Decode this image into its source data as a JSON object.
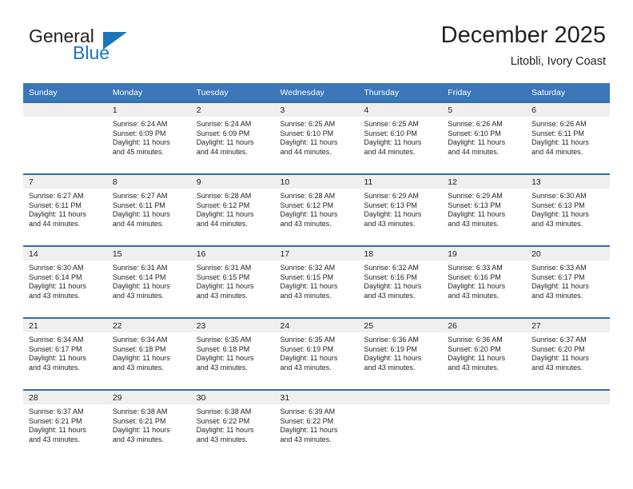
{
  "brand": {
    "name_part1": "General",
    "name_part2": "Blue",
    "color_dark": "#231f20",
    "color_blue": "#1b75bb"
  },
  "header": {
    "title": "December 2025",
    "subtitle": "Litobli, Ivory Coast"
  },
  "theme": {
    "header_row_bg": "#3a76b8",
    "row_divider": "#2e6ead",
    "daynum_band_bg": "#efefef",
    "text": "#231f20"
  },
  "weekday_headers": [
    "Sunday",
    "Monday",
    "Tuesday",
    "Wednesday",
    "Thursday",
    "Friday",
    "Saturday"
  ],
  "weeks": [
    [
      {
        "day": "",
        "sunrise": "",
        "sunset": "",
        "daylight1": "",
        "daylight2": ""
      },
      {
        "day": "1",
        "sunrise": "Sunrise: 6:24 AM",
        "sunset": "Sunset: 6:09 PM",
        "daylight1": "Daylight: 11 hours",
        "daylight2": "and 45 minutes."
      },
      {
        "day": "2",
        "sunrise": "Sunrise: 6:24 AM",
        "sunset": "Sunset: 6:09 PM",
        "daylight1": "Daylight: 11 hours",
        "daylight2": "and 44 minutes."
      },
      {
        "day": "3",
        "sunrise": "Sunrise: 6:25 AM",
        "sunset": "Sunset: 6:10 PM",
        "daylight1": "Daylight: 11 hours",
        "daylight2": "and 44 minutes."
      },
      {
        "day": "4",
        "sunrise": "Sunrise: 6:25 AM",
        "sunset": "Sunset: 6:10 PM",
        "daylight1": "Daylight: 11 hours",
        "daylight2": "and 44 minutes."
      },
      {
        "day": "5",
        "sunrise": "Sunrise: 6:26 AM",
        "sunset": "Sunset: 6:10 PM",
        "daylight1": "Daylight: 11 hours",
        "daylight2": "and 44 minutes."
      },
      {
        "day": "6",
        "sunrise": "Sunrise: 6:26 AM",
        "sunset": "Sunset: 6:11 PM",
        "daylight1": "Daylight: 11 hours",
        "daylight2": "and 44 minutes."
      }
    ],
    [
      {
        "day": "7",
        "sunrise": "Sunrise: 6:27 AM",
        "sunset": "Sunset: 6:11 PM",
        "daylight1": "Daylight: 11 hours",
        "daylight2": "and 44 minutes."
      },
      {
        "day": "8",
        "sunrise": "Sunrise: 6:27 AM",
        "sunset": "Sunset: 6:11 PM",
        "daylight1": "Daylight: 11 hours",
        "daylight2": "and 44 minutes."
      },
      {
        "day": "9",
        "sunrise": "Sunrise: 6:28 AM",
        "sunset": "Sunset: 6:12 PM",
        "daylight1": "Daylight: 11 hours",
        "daylight2": "and 44 minutes."
      },
      {
        "day": "10",
        "sunrise": "Sunrise: 6:28 AM",
        "sunset": "Sunset: 6:12 PM",
        "daylight1": "Daylight: 11 hours",
        "daylight2": "and 43 minutes."
      },
      {
        "day": "11",
        "sunrise": "Sunrise: 6:29 AM",
        "sunset": "Sunset: 6:13 PM",
        "daylight1": "Daylight: 11 hours",
        "daylight2": "and 43 minutes."
      },
      {
        "day": "12",
        "sunrise": "Sunrise: 6:29 AM",
        "sunset": "Sunset: 6:13 PM",
        "daylight1": "Daylight: 11 hours",
        "daylight2": "and 43 minutes."
      },
      {
        "day": "13",
        "sunrise": "Sunrise: 6:30 AM",
        "sunset": "Sunset: 6:13 PM",
        "daylight1": "Daylight: 11 hours",
        "daylight2": "and 43 minutes."
      }
    ],
    [
      {
        "day": "14",
        "sunrise": "Sunrise: 6:30 AM",
        "sunset": "Sunset: 6:14 PM",
        "daylight1": "Daylight: 11 hours",
        "daylight2": "and 43 minutes."
      },
      {
        "day": "15",
        "sunrise": "Sunrise: 6:31 AM",
        "sunset": "Sunset: 6:14 PM",
        "daylight1": "Daylight: 11 hours",
        "daylight2": "and 43 minutes."
      },
      {
        "day": "16",
        "sunrise": "Sunrise: 6:31 AM",
        "sunset": "Sunset: 6:15 PM",
        "daylight1": "Daylight: 11 hours",
        "daylight2": "and 43 minutes."
      },
      {
        "day": "17",
        "sunrise": "Sunrise: 6:32 AM",
        "sunset": "Sunset: 6:15 PM",
        "daylight1": "Daylight: 11 hours",
        "daylight2": "and 43 minutes."
      },
      {
        "day": "18",
        "sunrise": "Sunrise: 6:32 AM",
        "sunset": "Sunset: 6:16 PM",
        "daylight1": "Daylight: 11 hours",
        "daylight2": "and 43 minutes."
      },
      {
        "day": "19",
        "sunrise": "Sunrise: 6:33 AM",
        "sunset": "Sunset: 6:16 PM",
        "daylight1": "Daylight: 11 hours",
        "daylight2": "and 43 minutes."
      },
      {
        "day": "20",
        "sunrise": "Sunrise: 6:33 AM",
        "sunset": "Sunset: 6:17 PM",
        "daylight1": "Daylight: 11 hours",
        "daylight2": "and 43 minutes."
      }
    ],
    [
      {
        "day": "21",
        "sunrise": "Sunrise: 6:34 AM",
        "sunset": "Sunset: 6:17 PM",
        "daylight1": "Daylight: 11 hours",
        "daylight2": "and 43 minutes."
      },
      {
        "day": "22",
        "sunrise": "Sunrise: 6:34 AM",
        "sunset": "Sunset: 6:18 PM",
        "daylight1": "Daylight: 11 hours",
        "daylight2": "and 43 minutes."
      },
      {
        "day": "23",
        "sunrise": "Sunrise: 6:35 AM",
        "sunset": "Sunset: 6:18 PM",
        "daylight1": "Daylight: 11 hours",
        "daylight2": "and 43 minutes."
      },
      {
        "day": "24",
        "sunrise": "Sunrise: 6:35 AM",
        "sunset": "Sunset: 6:19 PM",
        "daylight1": "Daylight: 11 hours",
        "daylight2": "and 43 minutes."
      },
      {
        "day": "25",
        "sunrise": "Sunrise: 6:36 AM",
        "sunset": "Sunset: 6:19 PM",
        "daylight1": "Daylight: 11 hours",
        "daylight2": "and 43 minutes."
      },
      {
        "day": "26",
        "sunrise": "Sunrise: 6:36 AM",
        "sunset": "Sunset: 6:20 PM",
        "daylight1": "Daylight: 11 hours",
        "daylight2": "and 43 minutes."
      },
      {
        "day": "27",
        "sunrise": "Sunrise: 6:37 AM",
        "sunset": "Sunset: 6:20 PM",
        "daylight1": "Daylight: 11 hours",
        "daylight2": "and 43 minutes."
      }
    ],
    [
      {
        "day": "28",
        "sunrise": "Sunrise: 6:37 AM",
        "sunset": "Sunset: 6:21 PM",
        "daylight1": "Daylight: 11 hours",
        "daylight2": "and 43 minutes."
      },
      {
        "day": "29",
        "sunrise": "Sunrise: 6:38 AM",
        "sunset": "Sunset: 6:21 PM",
        "daylight1": "Daylight: 11 hours",
        "daylight2": "and 43 minutes."
      },
      {
        "day": "30",
        "sunrise": "Sunrise: 6:38 AM",
        "sunset": "Sunset: 6:22 PM",
        "daylight1": "Daylight: 11 hours",
        "daylight2": "and 43 minutes."
      },
      {
        "day": "31",
        "sunrise": "Sunrise: 6:39 AM",
        "sunset": "Sunset: 6:22 PM",
        "daylight1": "Daylight: 11 hours",
        "daylight2": "and 43 minutes."
      },
      {
        "day": "",
        "sunrise": "",
        "sunset": "",
        "daylight1": "",
        "daylight2": ""
      },
      {
        "day": "",
        "sunrise": "",
        "sunset": "",
        "daylight1": "",
        "daylight2": ""
      },
      {
        "day": "",
        "sunrise": "",
        "sunset": "",
        "daylight1": "",
        "daylight2": ""
      }
    ]
  ]
}
